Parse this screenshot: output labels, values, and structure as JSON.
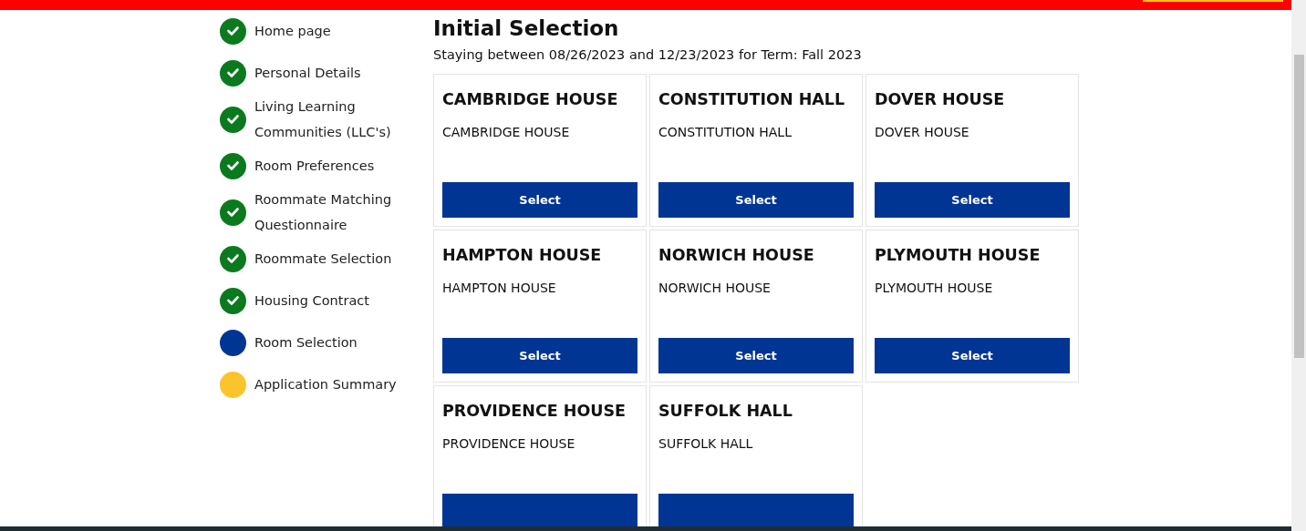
{
  "steps": [
    {
      "label": "Home page",
      "kind": "done"
    },
    {
      "label": "Personal Details",
      "kind": "done"
    },
    {
      "label": "Living Learning Communities (LLC's)",
      "kind": "done"
    },
    {
      "label": "Room Preferences",
      "kind": "done"
    },
    {
      "label": "Roommate Matching Questionnaire",
      "kind": "done"
    },
    {
      "label": "Roommate Selection",
      "kind": "done"
    },
    {
      "label": "Housing Contract",
      "kind": "done"
    },
    {
      "label": "Room Selection",
      "kind": "current"
    },
    {
      "label": "Application Summary",
      "kind": "pending"
    }
  ],
  "title": "Initial Selection",
  "subtitle": "Staying between 08/26/2023 and 12/23/2023 for Term: Fall 2023",
  "halls": [
    {
      "name": "CAMBRIDGE HOUSE",
      "description": "CAMBRIDGE HOUSE",
      "button": "Select"
    },
    {
      "name": "CONSTITUTION HALL",
      "description": "CONSTITUTION HALL",
      "button": "Select"
    },
    {
      "name": "DOVER HOUSE",
      "description": "DOVER HOUSE",
      "button": "Select"
    },
    {
      "name": "HAMPTON HOUSE",
      "description": "HAMPTON HOUSE",
      "button": "Select"
    },
    {
      "name": "NORWICH HOUSE",
      "description": "NORWICH HOUSE",
      "button": "Select"
    },
    {
      "name": "PLYMOUTH HOUSE",
      "description": "PLYMOUTH HOUSE",
      "button": "Select"
    },
    {
      "name": "PROVIDENCE HOUSE",
      "description": "PROVIDENCE HOUSE"
    },
    {
      "name": "SUFFOLK HALL",
      "description": "SUFFOLK HALL"
    }
  ]
}
